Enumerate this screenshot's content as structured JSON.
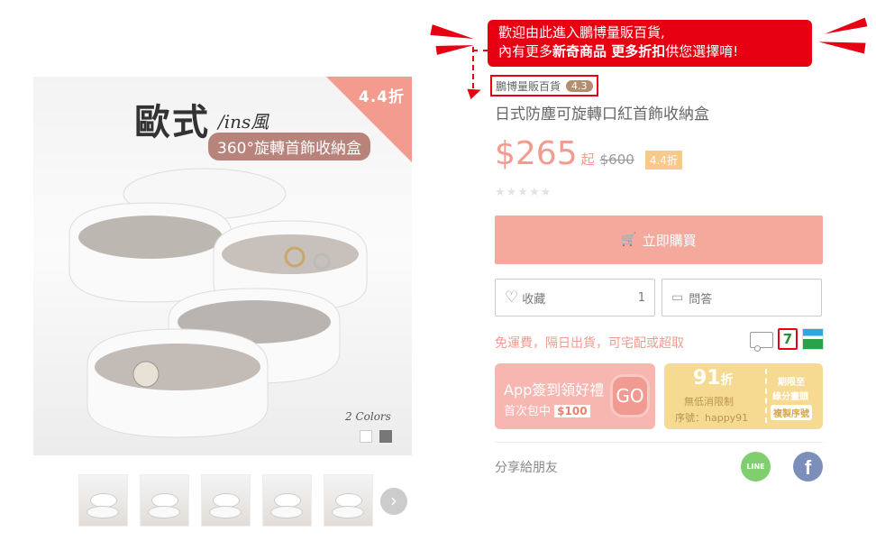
{
  "main_image": {
    "ribbon": "4.4折",
    "title_big": "歐式",
    "title_ins": "/ins風",
    "subtitle": "360°旋轉首飾收納盒",
    "colors_text": "2 Colors"
  },
  "thumbnails": {
    "next_label": "›"
  },
  "promo": {
    "line1": "歡迎由此進入鵬博量販百貨,",
    "line2_prefix": "內有更多",
    "line2_bold1": "新奇商品 更多折扣",
    "line2_suffix": "供您選擇唷!",
    "color": "#e60012"
  },
  "store": {
    "name": "鵬博量販百貨",
    "rating": "4.3"
  },
  "product": {
    "title": "日式防塵可旋轉口紅首飾收納盒",
    "price": "$265",
    "price_suffix": "起",
    "original_price": "$600",
    "discount": "4.4折",
    "stars": "★★★★★"
  },
  "actions": {
    "buy_label": "立即購買",
    "buy_icon": "🛒",
    "fav_label": "收藏",
    "fav_count": "1",
    "qa_label": "問答"
  },
  "shipping": {
    "text": "免運費，隔日出貨，可宅配或超取",
    "seven_label": "7"
  },
  "coupons": {
    "app_line1": "App簽到領好禮",
    "app_line2_prefix": "首次包中",
    "app_amount": "$100",
    "app_go": "GO",
    "code_big": "91",
    "code_big_suffix": "折",
    "code_note1": "無低消限制",
    "code_note2": "序號：happy91",
    "code_r1": "期限至",
    "code_r2": "綠分畫頭",
    "code_copy": "複製序號"
  },
  "share": {
    "label": "分享給朋友",
    "line_label": "LINE",
    "fb_label": "f"
  },
  "colors": {
    "accent": "#f29b8e",
    "buy": "#f5a99d",
    "app_coupon": "#f7b7b0",
    "code_coupon": "#f6da92"
  }
}
